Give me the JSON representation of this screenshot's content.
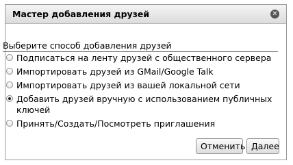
{
  "dialog": {
    "title": "Мастер добавления друзей",
    "close_icon": "close-icon"
  },
  "prompt": "Выберите способ добавления друзей",
  "options": [
    {
      "label": "Подписаться на ленту друзей с общественного сервера",
      "checked": false
    },
    {
      "label": "Импортировать друзей из GMail/Google Talk",
      "checked": false
    },
    {
      "label": "Импортировать друзей из вашей локальной сети",
      "checked": false
    },
    {
      "label": "Добавить друзей вручную с использованием публичных ключей",
      "checked": true
    },
    {
      "label": "Принять/Создать/Посмотреть приглашения",
      "checked": false
    }
  ],
  "buttons": {
    "cancel": "Отменить",
    "next": "Далее"
  }
}
